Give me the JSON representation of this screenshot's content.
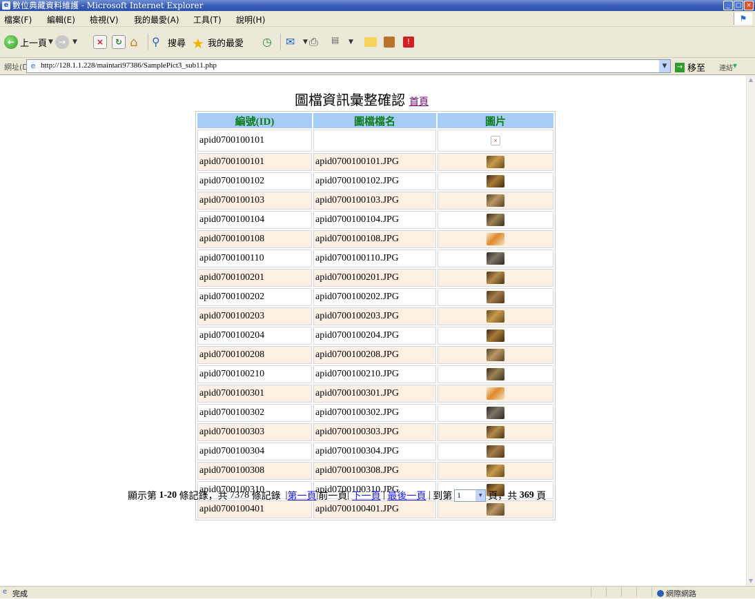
{
  "window": {
    "title": "數位典藏資料維護 - Microsoft Internet Explorer"
  },
  "menu": [
    "檔案(F)",
    "編輯(E)",
    "檢視(V)",
    "我的最愛(A)",
    "工具(T)",
    "說明(H)"
  ],
  "toolbar": {
    "back_label": "上一頁",
    "search_label": "搜尋",
    "favorites_label": "我的最愛"
  },
  "address": {
    "label": "網址(D)",
    "url": "http://128.1.1.228/maintari97386/SamplePict3_sub11.php",
    "go_label": "移至",
    "links_label": "連結"
  },
  "page": {
    "heading": "圖檔資訊彙整確認",
    "home_link": "首頁",
    "columns": [
      "編號(ID)",
      "圖檔檔名",
      "圖片"
    ],
    "first_row": {
      "id": "apid0700100101",
      "filename": ""
    },
    "rows": [
      {
        "id": "apid0700100101",
        "filename": "apid0700100101.JPG"
      },
      {
        "id": "apid0700100102",
        "filename": "apid0700100102.JPG"
      },
      {
        "id": "apid0700100103",
        "filename": "apid0700100103.JPG"
      },
      {
        "id": "apid0700100104",
        "filename": "apid0700100104.JPG"
      },
      {
        "id": "apid0700100108",
        "filename": "apid0700100108.JPG"
      },
      {
        "id": "apid0700100110",
        "filename": "apid0700100110.JPG"
      },
      {
        "id": "apid0700100201",
        "filename": "apid0700100201.JPG"
      },
      {
        "id": "apid0700100202",
        "filename": "apid0700100202.JPG"
      },
      {
        "id": "apid0700100203",
        "filename": "apid0700100203.JPG"
      },
      {
        "id": "apid0700100204",
        "filename": "apid0700100204.JPG"
      },
      {
        "id": "apid0700100208",
        "filename": "apid0700100208.JPG"
      },
      {
        "id": "apid0700100210",
        "filename": "apid0700100210.JPG"
      },
      {
        "id": "apid0700100301",
        "filename": "apid0700100301.JPG"
      },
      {
        "id": "apid0700100302",
        "filename": "apid0700100302.JPG"
      },
      {
        "id": "apid0700100303",
        "filename": "apid0700100303.JPG"
      },
      {
        "id": "apid0700100304",
        "filename": "apid0700100304.JPG"
      },
      {
        "id": "apid0700100308",
        "filename": "apid0700100308.JPG"
      },
      {
        "id": "apid0700100310",
        "filename": "apid0700100310.JPG"
      },
      {
        "id": "apid0700100401",
        "filename": "apid0700100401.JPG"
      }
    ],
    "pager": {
      "prefix": "顯示第",
      "range": "1-20",
      "mid": "條記錄，共",
      "total": "7378",
      "suffix": "條記錄",
      "first": "第一頁",
      "prev": "前一頁",
      "next": "下一頁",
      "last": "最後一頁",
      "goto_prefix": "到第",
      "page_value": "1",
      "goto_mid": "頁，共",
      "pages": "369",
      "goto_suffix": "頁"
    }
  },
  "status": {
    "text": "完成",
    "zone": "網際網路"
  },
  "colors": {
    "header_bg": "#a7cdf6",
    "header_text": "#0c7c1c",
    "odd_row": "#fcefe3",
    "link": "#1a1aee",
    "visited_link": "#800080"
  }
}
